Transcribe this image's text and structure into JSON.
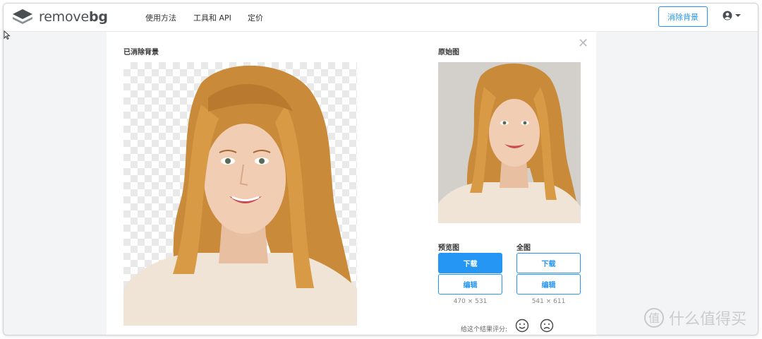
{
  "header": {
    "logo_text_light": "remove",
    "logo_text_bold": "bg",
    "nav": [
      "使用方法",
      "工具和 API",
      "定价"
    ],
    "cta_label": "消除背景",
    "account_icon": "user-circle-icon"
  },
  "panel": {
    "result_title": "已消除背景",
    "original_title": "原始图",
    "close_icon": "close-icon"
  },
  "downloads": {
    "preview": {
      "title": "预览图",
      "download": "下载",
      "edit": "编辑",
      "size": "470 × 531"
    },
    "full": {
      "title": "全图",
      "download": "下载",
      "edit": "编辑",
      "size": "541 × 611"
    }
  },
  "rating": {
    "label": "给这个结果评分:"
  },
  "watermark": {
    "text": "什么值得买"
  },
  "colors": {
    "accent": "#2596f3",
    "hair": "#c98a3a",
    "skin": "#f1cdb3"
  }
}
